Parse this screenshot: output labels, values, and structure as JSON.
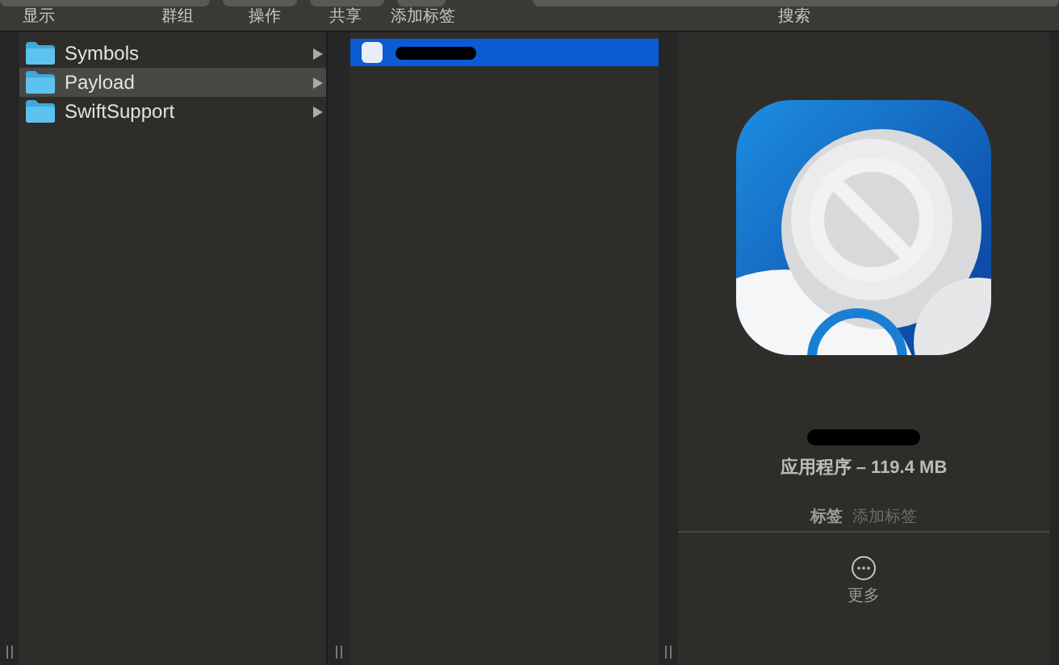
{
  "toolbar": {
    "labels": [
      "显示",
      "群组",
      "操作",
      "共享",
      "添加标签"
    ],
    "search_label": "搜索"
  },
  "column_1": {
    "items": [
      {
        "name": "Symbols",
        "selected": false
      },
      {
        "name": "Payload",
        "selected": true
      },
      {
        "name": "SwiftSupport",
        "selected": false
      }
    ]
  },
  "column_2": {
    "items": [
      {
        "selected": true
      }
    ]
  },
  "preview": {
    "kind_size": "应用程序 – 119.4 MB",
    "tags_label": "标签",
    "tags_placeholder": "添加标签",
    "more_label": "更多"
  }
}
